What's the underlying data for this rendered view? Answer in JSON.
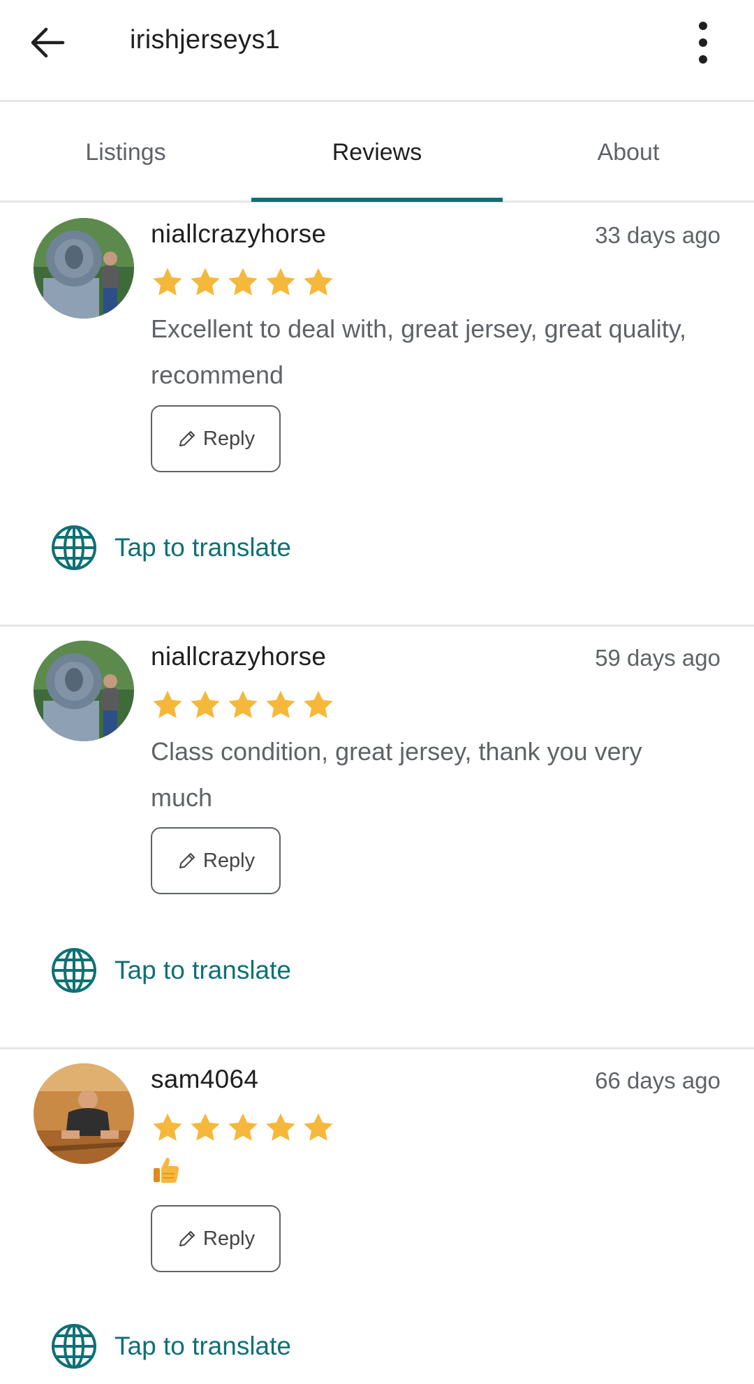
{
  "header": {
    "title": "irishjerseys1",
    "back_icon": "arrow-left-icon",
    "more_icon": "more-vertical-icon"
  },
  "tabs": [
    {
      "label": "Listings",
      "active": false
    },
    {
      "label": "Reviews",
      "active": true
    },
    {
      "label": "About",
      "active": false
    }
  ],
  "colors": {
    "accent": "#0f7074",
    "star": "#f6b83b",
    "divider": "#e6e6e6",
    "secondary_text": "#5f6368"
  },
  "reviews": [
    {
      "reviewer": "niallcrazyhorse",
      "date": "33 days ago",
      "rating": 5,
      "text": "Excellent to deal with, great jersey, great quality, recommend",
      "reply_label": "Reply",
      "translate_label": "Tap to translate"
    },
    {
      "reviewer": "niallcrazyhorse",
      "date": "59 days ago",
      "rating": 5,
      "text": "Class condition, great jersey, thank you very much",
      "reply_label": "Reply",
      "translate_label": "Tap to translate"
    },
    {
      "reviewer": "sam4064",
      "date": "66 days ago",
      "rating": 5,
      "text": "",
      "emoji_icon": "thumbs-up-icon",
      "reply_label": "Reply",
      "translate_label": "Tap to translate"
    }
  ]
}
